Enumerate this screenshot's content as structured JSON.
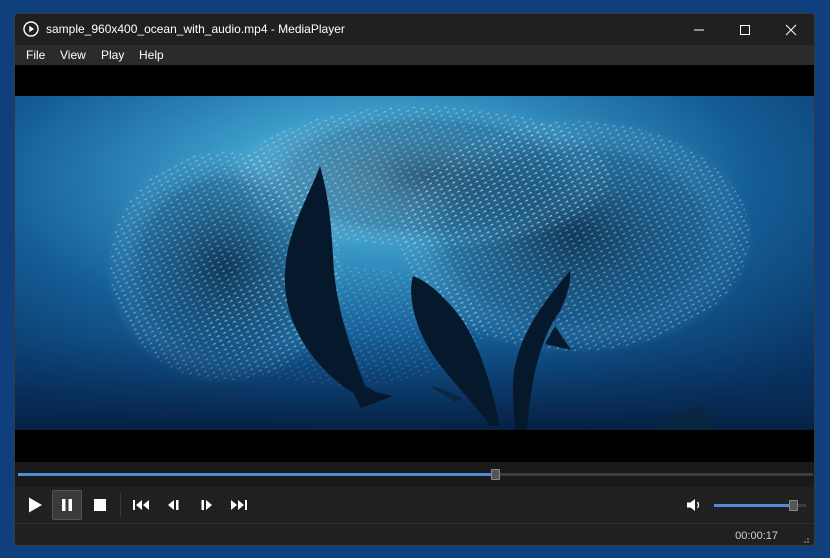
{
  "window": {
    "title": "sample_960x400_ocean_with_audio.mp4 - MediaPlayer",
    "app_icon": "play-circle-icon"
  },
  "menu": {
    "items": [
      {
        "label": "File"
      },
      {
        "label": "View"
      },
      {
        "label": "Play"
      },
      {
        "label": "Help"
      }
    ]
  },
  "player": {
    "playback_progress": 0.6,
    "volume_level": 0.86,
    "elapsed_time": "00:00:17",
    "colors": {
      "accent": "#4a90d9",
      "background": "#202020"
    }
  },
  "controls": {
    "icons": [
      "play-icon",
      "pause-icon",
      "stop-icon",
      "skip-previous-icon",
      "step-back-icon",
      "step-forward-icon",
      "skip-next-icon",
      "volume-icon"
    ]
  }
}
